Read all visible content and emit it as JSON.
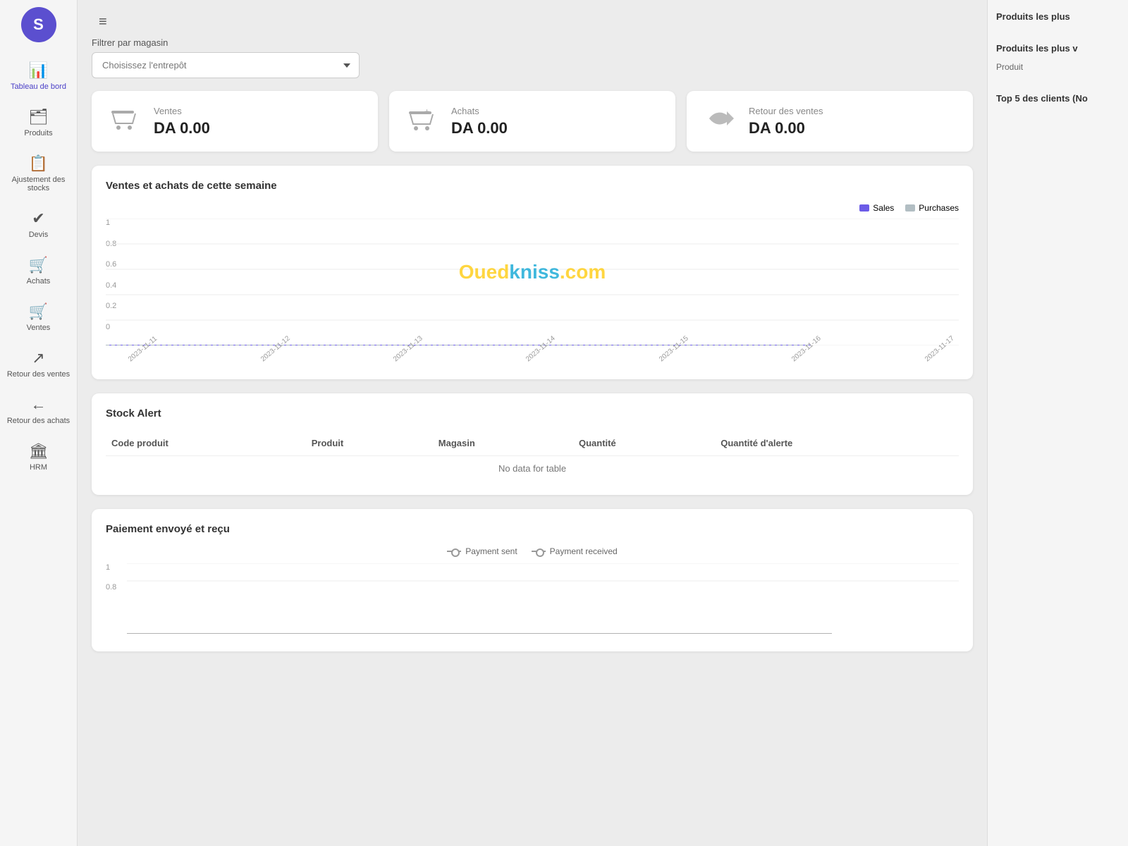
{
  "app": {
    "logo_letter": "S",
    "menu_icon": "≡"
  },
  "sidebar": {
    "items": [
      {
        "id": "tableau-de-bord",
        "label": "Tableau de bord",
        "icon": "📊"
      },
      {
        "id": "produits",
        "label": "Produits",
        "icon": "🗂️"
      },
      {
        "id": "ajustement-stocks",
        "label": "Ajustement des stocks",
        "icon": "📋"
      },
      {
        "id": "devis",
        "label": "Devis",
        "icon": "✔️"
      },
      {
        "id": "achats",
        "label": "Achats",
        "icon": "🛒"
      },
      {
        "id": "ventes",
        "label": "Ventes",
        "icon": "🛒"
      },
      {
        "id": "retour-ventes",
        "label": "Retour des ventes",
        "icon": "↗️"
      },
      {
        "id": "retour-achats",
        "label": "Retour des achats",
        "icon": "←"
      },
      {
        "id": "hrm",
        "label": "HRM",
        "icon": "🏛️"
      }
    ]
  },
  "filter": {
    "label": "Filtrer par magasin",
    "placeholder": "Choisissez l'entrepôt",
    "options": [
      "Choisissez l'entrepôt"
    ]
  },
  "summary_cards": [
    {
      "id": "ventes",
      "title": "Ventes",
      "value": "DA 0.00",
      "icon": "🛒"
    },
    {
      "id": "achats",
      "title": "Achats",
      "value": "DA 0.00",
      "icon": "🛒"
    },
    {
      "id": "retour-ventes",
      "title": "Retour des ventes",
      "value": "DA 0.00",
      "icon": "↗"
    }
  ],
  "weekly_chart": {
    "title": "Ventes et achats de cette semaine",
    "legend": {
      "sales_label": "Sales",
      "purchases_label": "Purchases",
      "sales_color": "#6c5ce7",
      "purchases_color": "#b2bec3"
    },
    "y_labels": [
      "1",
      "0.8",
      "0.6",
      "0.4",
      "0.2",
      "0"
    ],
    "x_labels": [
      "2023-11-11",
      "2023-11-12",
      "2023-11-13",
      "2023-11-14",
      "2023-11-15",
      "2023-11-16",
      "2023-11-17"
    ]
  },
  "stock_alert": {
    "title": "Stock Alert",
    "columns": [
      "Code produit",
      "Produit",
      "Magasin",
      "Quantité",
      "Quantité d'alerte"
    ],
    "no_data": "No data for table"
  },
  "payment": {
    "title": "Paiement envoyé et reçu",
    "legend": {
      "sent_label": "Payment sent",
      "received_label": "Payment received"
    },
    "y_labels": [
      "1",
      "0.8"
    ]
  },
  "right_panel": {
    "top_section_title": "Produits les plus",
    "bottom_section_title": "Produits les plus v",
    "product_label": "Produit",
    "top5_title": "Top 5 des clients (No"
  },
  "watermark": {
    "part1": "Oued",
    "part2": "kniss",
    "part3": ".com"
  }
}
